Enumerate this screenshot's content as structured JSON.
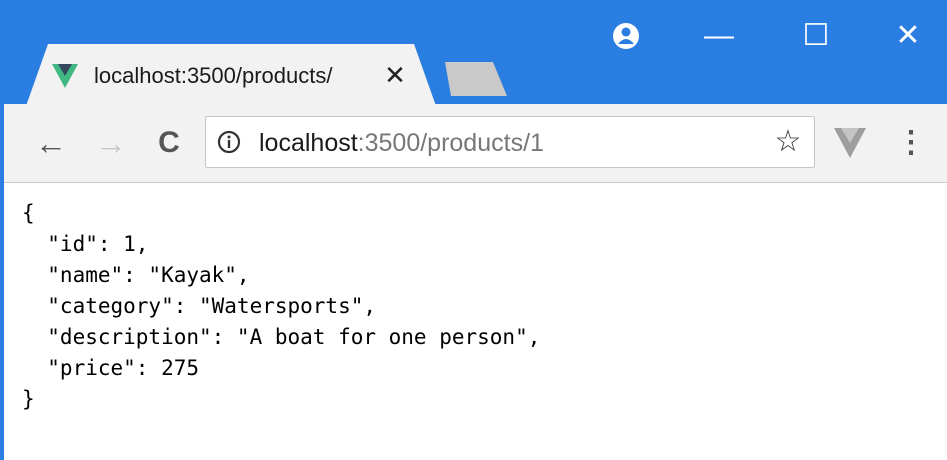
{
  "browser": {
    "tab": {
      "title": "localhost:3500/products/",
      "close_glyph": "✕",
      "favicon": "vue-logo-icon"
    },
    "window_controls": {
      "profile_icon": "profile-icon",
      "minimize_glyph": "—",
      "maximize_glyph": "☐",
      "close_glyph": "✕"
    },
    "toolbar": {
      "back_glyph": "←",
      "forward_glyph": "→",
      "reload_glyph": "C",
      "star_glyph": "☆",
      "menu_glyph": "⋮",
      "extension_icon": "vue-devtools-icon"
    },
    "address_bar": {
      "host": "localhost",
      "rest": ":3500/products/1",
      "info_icon": "info-icon"
    },
    "colors": {
      "titlebar": "#2a7de1",
      "vue_green": "#41b883",
      "vue_dark": "#35495e"
    }
  },
  "page": {
    "json_text": "{\n  \"id\": 1,\n  \"name\": \"Kayak\",\n  \"category\": \"Watersports\",\n  \"description\": \"A boat for one person\",\n  \"price\": 275\n}"
  }
}
